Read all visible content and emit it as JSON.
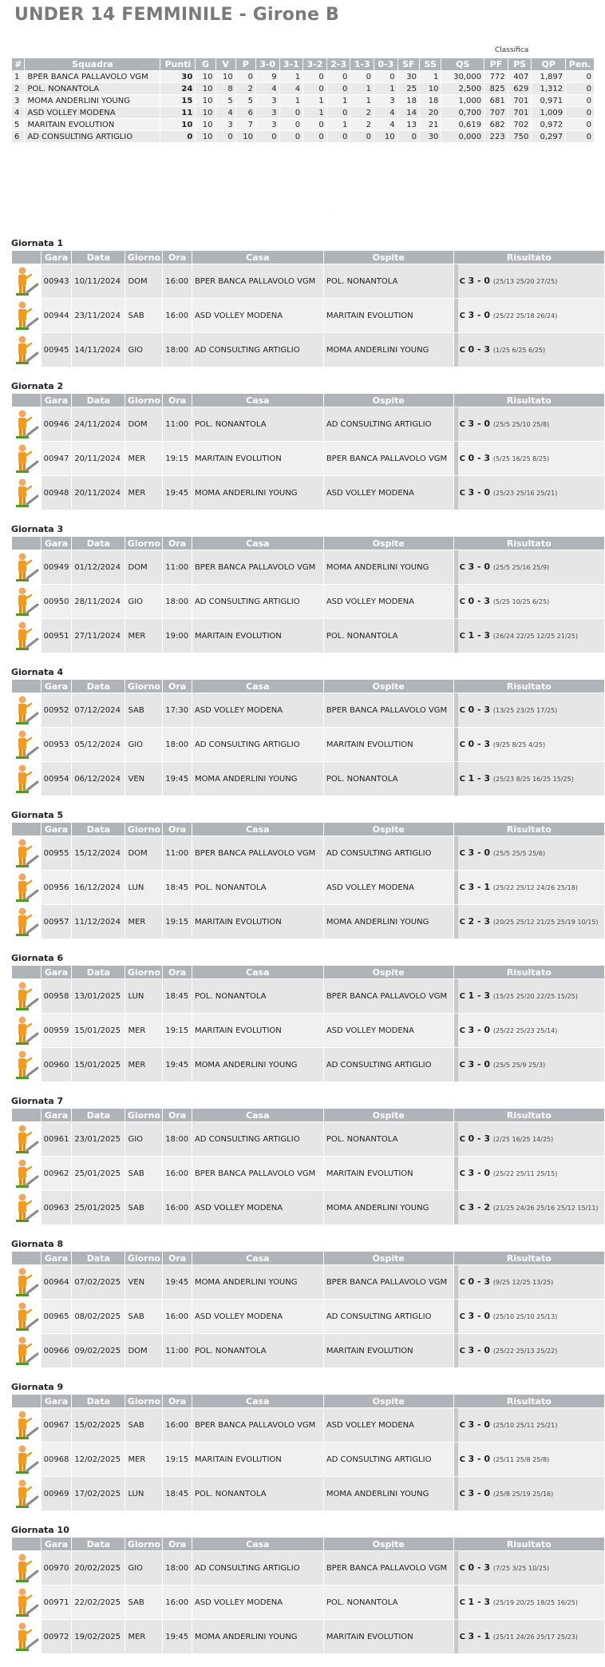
{
  "title": "UNDER 14 FEMMINILE - Girone B",
  "classifica_label": "Classifica",
  "standings_headers": [
    "#",
    "Squadra",
    "Punti",
    "G",
    "V",
    "P",
    "3-0",
    "3-1",
    "3-2",
    "2-3",
    "1-3",
    "0-3",
    "SF",
    "SS",
    "QS",
    "PF",
    "PS",
    "QP",
    "Pen."
  ],
  "standings": [
    [
      "1",
      "BPER BANCA PALLAVOLO VGM",
      "30",
      "10",
      "10",
      "0",
      "9",
      "1",
      "0",
      "0",
      "0",
      "0",
      "30",
      "1",
      "30,000",
      "772",
      "407",
      "1,897",
      "0"
    ],
    [
      "2",
      "POL. NONANTOLA",
      "24",
      "10",
      "8",
      "2",
      "4",
      "4",
      "0",
      "0",
      "1",
      "1",
      "25",
      "10",
      "2,500",
      "825",
      "629",
      "1,312",
      "0"
    ],
    [
      "3",
      "MOMA ANDERLINI YOUNG",
      "15",
      "10",
      "5",
      "5",
      "3",
      "1",
      "1",
      "1",
      "1",
      "3",
      "18",
      "18",
      "1,000",
      "681",
      "701",
      "0,971",
      "0"
    ],
    [
      "4",
      "ASD VOLLEY MODENA",
      "11",
      "10",
      "4",
      "6",
      "3",
      "0",
      "1",
      "0",
      "2",
      "4",
      "14",
      "20",
      "0,700",
      "707",
      "701",
      "1,009",
      "0"
    ],
    [
      "5",
      "MARITAIN EVOLUTION",
      "10",
      "10",
      "3",
      "7",
      "3",
      "0",
      "0",
      "1",
      "2",
      "4",
      "13",
      "21",
      "0,619",
      "682",
      "702",
      "0,972",
      "0"
    ],
    [
      "6",
      "AD CONSULTING ARTIGLIO",
      "0",
      "10",
      "0",
      "10",
      "0",
      "0",
      "0",
      "0",
      "0",
      "10",
      "0",
      "30",
      "0,000",
      "223",
      "750",
      "0,297",
      "0"
    ]
  ],
  "round_headers": [
    "Gara",
    "Data",
    "Giorno",
    "Ora",
    "Casa",
    "Ospite",
    "Risultato"
  ],
  "result_prefix": "C",
  "icon": "volleyball-referee-icon",
  "rounds": [
    {
      "title": "Giornata 1",
      "matches": [
        {
          "gara": "00943",
          "data": "10/11/2024",
          "giorno": "DOM",
          "ora": "16:00",
          "casa": "BPER BANCA PALLAVOLO VGM",
          "ospite": "POL. NONANTOLA",
          "score": "3 - 0",
          "sets": "(25/13 25/20 27/25)"
        },
        {
          "gara": "00944",
          "data": "23/11/2024",
          "giorno": "SAB",
          "ora": "16:00",
          "casa": "ASD VOLLEY MODENA",
          "ospite": "MARITAIN EVOLUTION",
          "score": "3 - 0",
          "sets": "(25/22 25/18 26/24)"
        },
        {
          "gara": "00945",
          "data": "14/11/2024",
          "giorno": "GIO",
          "ora": "18:00",
          "casa": "AD CONSULTING ARTIGLIO",
          "ospite": "MOMA ANDERLINI YOUNG",
          "score": "0 - 3",
          "sets": "(1/25 6/25 6/25)"
        }
      ]
    },
    {
      "title": "Giornata 2",
      "matches": [
        {
          "gara": "00946",
          "data": "24/11/2024",
          "giorno": "DOM",
          "ora": "11:00",
          "casa": "POL. NONANTOLA",
          "ospite": "AD CONSULTING ARTIGLIO",
          "score": "3 - 0",
          "sets": "(25/5 25/10 25/8)"
        },
        {
          "gara": "00947",
          "data": "20/11/2024",
          "giorno": "MER",
          "ora": "19:15",
          "casa": "MARITAIN EVOLUTION",
          "ospite": "BPER BANCA PALLAVOLO VGM",
          "score": "0 - 3",
          "sets": "(5/25 16/25 8/25)"
        },
        {
          "gara": "00948",
          "data": "20/11/2024",
          "giorno": "MER",
          "ora": "19:45",
          "casa": "MOMA ANDERLINI YOUNG",
          "ospite": "ASD VOLLEY MODENA",
          "score": "3 - 0",
          "sets": "(25/23 25/16 25/21)"
        }
      ]
    },
    {
      "title": "Giornata 3",
      "matches": [
        {
          "gara": "00949",
          "data": "01/12/2024",
          "giorno": "DOM",
          "ora": "11:00",
          "casa": "BPER BANCA PALLAVOLO VGM",
          "ospite": "MOMA ANDERLINI YOUNG",
          "score": "3 - 0",
          "sets": "(25/5 25/16 25/9)"
        },
        {
          "gara": "00950",
          "data": "28/11/2024",
          "giorno": "GIO",
          "ora": "18:00",
          "casa": "AD CONSULTING ARTIGLIO",
          "ospite": "ASD VOLLEY MODENA",
          "score": "0 - 3",
          "sets": "(5/25 10/25 6/25)"
        },
        {
          "gara": "00951",
          "data": "27/11/2024",
          "giorno": "MER",
          "ora": "19:00",
          "casa": "MARITAIN EVOLUTION",
          "ospite": "POL. NONANTOLA",
          "score": "1 - 3",
          "sets": "(26/24 22/25 12/25 21/25)"
        }
      ]
    },
    {
      "title": "Giornata 4",
      "matches": [
        {
          "gara": "00952",
          "data": "07/12/2024",
          "giorno": "SAB",
          "ora": "17:30",
          "casa": "ASD VOLLEY MODENA",
          "ospite": "BPER BANCA PALLAVOLO VGM",
          "score": "0 - 3",
          "sets": "(13/25 23/25 17/25)"
        },
        {
          "gara": "00953",
          "data": "05/12/2024",
          "giorno": "GIO",
          "ora": "18:00",
          "casa": "AD CONSULTING ARTIGLIO",
          "ospite": "MARITAIN EVOLUTION",
          "score": "0 - 3",
          "sets": "(9/25 8/25 4/25)"
        },
        {
          "gara": "00954",
          "data": "06/12/2024",
          "giorno": "VEN",
          "ora": "19:45",
          "casa": "MOMA ANDERLINI YOUNG",
          "ospite": "POL. NONANTOLA",
          "score": "1 - 3",
          "sets": "(25/23 8/25 16/25 15/25)"
        }
      ]
    },
    {
      "title": "Giornata 5",
      "matches": [
        {
          "gara": "00955",
          "data": "15/12/2024",
          "giorno": "DOM",
          "ora": "11:00",
          "casa": "BPER BANCA PALLAVOLO VGM",
          "ospite": "AD CONSULTING ARTIGLIO",
          "score": "3 - 0",
          "sets": "(25/5 25/5 25/6)"
        },
        {
          "gara": "00956",
          "data": "16/12/2024",
          "giorno": "LUN",
          "ora": "18:45",
          "casa": "POL. NONANTOLA",
          "ospite": "ASD VOLLEY MODENA",
          "score": "3 - 1",
          "sets": "(25/22 25/12 24/26 25/18)"
        },
        {
          "gara": "00957",
          "data": "11/12/2024",
          "giorno": "MER",
          "ora": "19:15",
          "casa": "MARITAIN EVOLUTION",
          "ospite": "MOMA ANDERLINI YOUNG",
          "score": "2 - 3",
          "sets": "(20/25 25/12 21/25 25/19 10/15)"
        }
      ]
    },
    {
      "title": "Giornata 6",
      "matches": [
        {
          "gara": "00958",
          "data": "13/01/2025",
          "giorno": "LUN",
          "ora": "18:45",
          "casa": "POL. NONANTOLA",
          "ospite": "BPER BANCA PALLAVOLO VGM",
          "score": "1 - 3",
          "sets": "(15/25 25/20 22/25 15/25)"
        },
        {
          "gara": "00959",
          "data": "15/01/2025",
          "giorno": "MER",
          "ora": "19:15",
          "casa": "MARITAIN EVOLUTION",
          "ospite": "ASD VOLLEY MODENA",
          "score": "3 - 0",
          "sets": "(25/22 25/23 25/14)"
        },
        {
          "gara": "00960",
          "data": "15/01/2025",
          "giorno": "MER",
          "ora": "19:45",
          "casa": "MOMA ANDERLINI YOUNG",
          "ospite": "AD CONSULTING ARTIGLIO",
          "score": "3 - 0",
          "sets": "(25/5 25/9 25/3)"
        }
      ]
    },
    {
      "title": "Giornata 7",
      "matches": [
        {
          "gara": "00961",
          "data": "23/01/2025",
          "giorno": "GIO",
          "ora": "18:00",
          "casa": "AD CONSULTING ARTIGLIO",
          "ospite": "POL. NONANTOLA",
          "score": "0 - 3",
          "sets": "(2/25 16/25 14/25)"
        },
        {
          "gara": "00962",
          "data": "25/01/2025",
          "giorno": "SAB",
          "ora": "16:00",
          "casa": "BPER BANCA PALLAVOLO VGM",
          "ospite": "MARITAIN EVOLUTION",
          "score": "3 - 0",
          "sets": "(25/22 25/11 25/15)"
        },
        {
          "gara": "00963",
          "data": "25/01/2025",
          "giorno": "SAB",
          "ora": "16:00",
          "casa": "ASD VOLLEY MODENA",
          "ospite": "MOMA ANDERLINI YOUNG",
          "score": "3 - 2",
          "sets": "(21/25 24/26 25/16 25/12 15/11)"
        }
      ]
    },
    {
      "title": "Giornata 8",
      "matches": [
        {
          "gara": "00964",
          "data": "07/02/2025",
          "giorno": "VEN",
          "ora": "19:45",
          "casa": "MOMA ANDERLINI YOUNG",
          "ospite": "BPER BANCA PALLAVOLO VGM",
          "score": "0 - 3",
          "sets": "(9/25 12/25 13/25)"
        },
        {
          "gara": "00965",
          "data": "08/02/2025",
          "giorno": "SAB",
          "ora": "16:00",
          "casa": "ASD VOLLEY MODENA",
          "ospite": "AD CONSULTING ARTIGLIO",
          "score": "3 - 0",
          "sets": "(25/10 25/10 25/13)"
        },
        {
          "gara": "00966",
          "data": "09/02/2025",
          "giorno": "DOM",
          "ora": "11:00",
          "casa": "POL. NONANTOLA",
          "ospite": "MARITAIN EVOLUTION",
          "score": "3 - 0",
          "sets": "(25/22 25/13 25/22)"
        }
      ]
    },
    {
      "title": "Giornata 9",
      "matches": [
        {
          "gara": "00967",
          "data": "15/02/2025",
          "giorno": "SAB",
          "ora": "16:00",
          "casa": "BPER BANCA PALLAVOLO VGM",
          "ospite": "ASD VOLLEY MODENA",
          "score": "3 - 0",
          "sets": "(25/10 25/11 25/21)"
        },
        {
          "gara": "00968",
          "data": "12/02/2025",
          "giorno": "MER",
          "ora": "19:15",
          "casa": "MARITAIN EVOLUTION",
          "ospite": "AD CONSULTING ARTIGLIO",
          "score": "3 - 0",
          "sets": "(25/11 25/8 25/8)"
        },
        {
          "gara": "00969",
          "data": "17/02/2025",
          "giorno": "LUN",
          "ora": "18:45",
          "casa": "POL. NONANTOLA",
          "ospite": "MOMA ANDERLINI YOUNG",
          "score": "3 - 0",
          "sets": "(25/8 25/19 25/16)"
        }
      ]
    },
    {
      "title": "Giornata 10",
      "matches": [
        {
          "gara": "00970",
          "data": "20/02/2025",
          "giorno": "GIO",
          "ora": "18:00",
          "casa": "AD CONSULTING ARTIGLIO",
          "ospite": "BPER BANCA PALLAVOLO VGM",
          "score": "0 - 3",
          "sets": "(7/25 3/25 10/25)"
        },
        {
          "gara": "00971",
          "data": "22/02/2025",
          "giorno": "SAB",
          "ora": "16:00",
          "casa": "ASD VOLLEY MODENA",
          "ospite": "POL. NONANTOLA",
          "score": "1 - 3",
          "sets": "(25/19 20/25 18/25 16/25)"
        },
        {
          "gara": "00972",
          "data": "19/02/2025",
          "giorno": "MER",
          "ora": "19:45",
          "casa": "MOMA ANDERLINI YOUNG",
          "ospite": "MARITAIN EVOLUTION",
          "score": "3 - 1",
          "sets": "(25/11 24/26 25/17 25/23)"
        }
      ]
    }
  ]
}
